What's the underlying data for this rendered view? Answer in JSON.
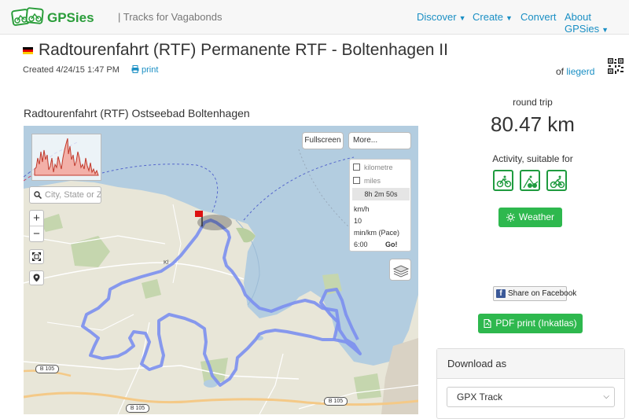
{
  "header": {
    "logo_text": "GPSies",
    "tagline": "| Tracks for Vagabonds",
    "nav": [
      {
        "label": "Discover",
        "dropdown": true
      },
      {
        "label": "Create",
        "dropdown": true
      },
      {
        "label": "Convert",
        "dropdown": false
      },
      {
        "label": "About GPSies",
        "dropdown": true
      }
    ]
  },
  "track": {
    "flag_colors": [
      "#000000",
      "#dd0000",
      "#ffce00"
    ],
    "title": "Radtourenfahrt (RTF)  Permanente RTF - Boltenhagen II",
    "created": "Created 4/24/15 1:47 PM",
    "print_label": "print",
    "of_label": "of",
    "author": "liegerd",
    "subtitle": "Radtourenfahrt (RTF) Ostseebad Boltenhagen"
  },
  "map": {
    "search_placeholder": "City, State or Zip",
    "zoom_in": "+",
    "zoom_out": "−",
    "fullscreen_label": "Fullscreen",
    "more_label": "More...",
    "unit_km": "kilometre",
    "unit_miles": "miles",
    "duration": "8h 2m 50s",
    "speed_label": "km/h",
    "speed_value": "10",
    "pace_label": "min/km (Pace)",
    "pace_value": "6:00",
    "go_label": "Go!",
    "town_label": "Kl",
    "road_labels": [
      "B 105",
      "B 105",
      "B 105"
    ],
    "icons": [
      "search-icon",
      "fullscreen-icon",
      "location-pin-icon",
      "layers-icon",
      "start-flag-icon"
    ],
    "route_color": "#7b8ff0",
    "water_color": "#b3cde0"
  },
  "sidebar": {
    "trip_type": "round trip",
    "distance": "80.47 km",
    "activity_label": "Activity, suitable for",
    "activity_icons": [
      "bike-icon",
      "mountain-bike-icon",
      "racing-bike-icon"
    ],
    "weather_label": "Weather",
    "facebook_label": "Share on Facebook",
    "pdf_label": "PDF print (Inkatlas)",
    "download_title": "Download as",
    "download_format": "GPX Track",
    "accent_color": "#2eb84e"
  }
}
